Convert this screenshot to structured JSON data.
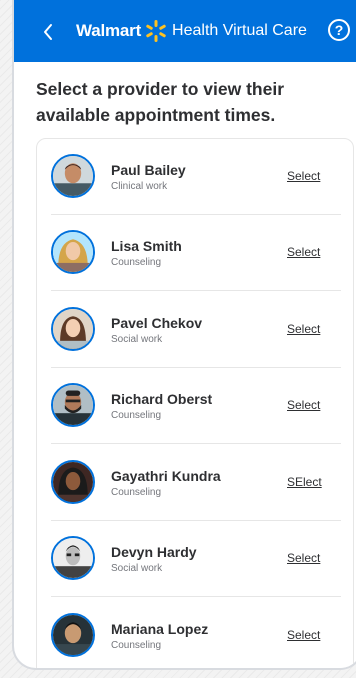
{
  "header": {
    "brand_name": "Walmart",
    "service_title": "Health Virtual Care",
    "back_icon": "chevron-left-icon",
    "help_icon": "question-circle-icon",
    "help_glyph": "?",
    "background_color": "#0071dc",
    "spark_color": "#ffc220"
  },
  "page": {
    "title": "Select a provider to view their available appointment times."
  },
  "providers": [
    {
      "name": "Paul Bailey",
      "specialty": "Clinical work",
      "action": "Select"
    },
    {
      "name": "Lisa Smith",
      "specialty": "Counseling",
      "action": "Select"
    },
    {
      "name": "Pavel Chekov",
      "specialty": "Social work",
      "action": "Select"
    },
    {
      "name": "Richard Oberst",
      "specialty": "Counseling",
      "action": "Select"
    },
    {
      "name": "Gayathri Kundra",
      "specialty": "Counseling",
      "action": "SElect"
    },
    {
      "name": "Devyn Hardy",
      "specialty": "Social work",
      "action": "Select"
    },
    {
      "name": "Mariana Lopez",
      "specialty": "Counseling",
      "action": "Select"
    }
  ]
}
